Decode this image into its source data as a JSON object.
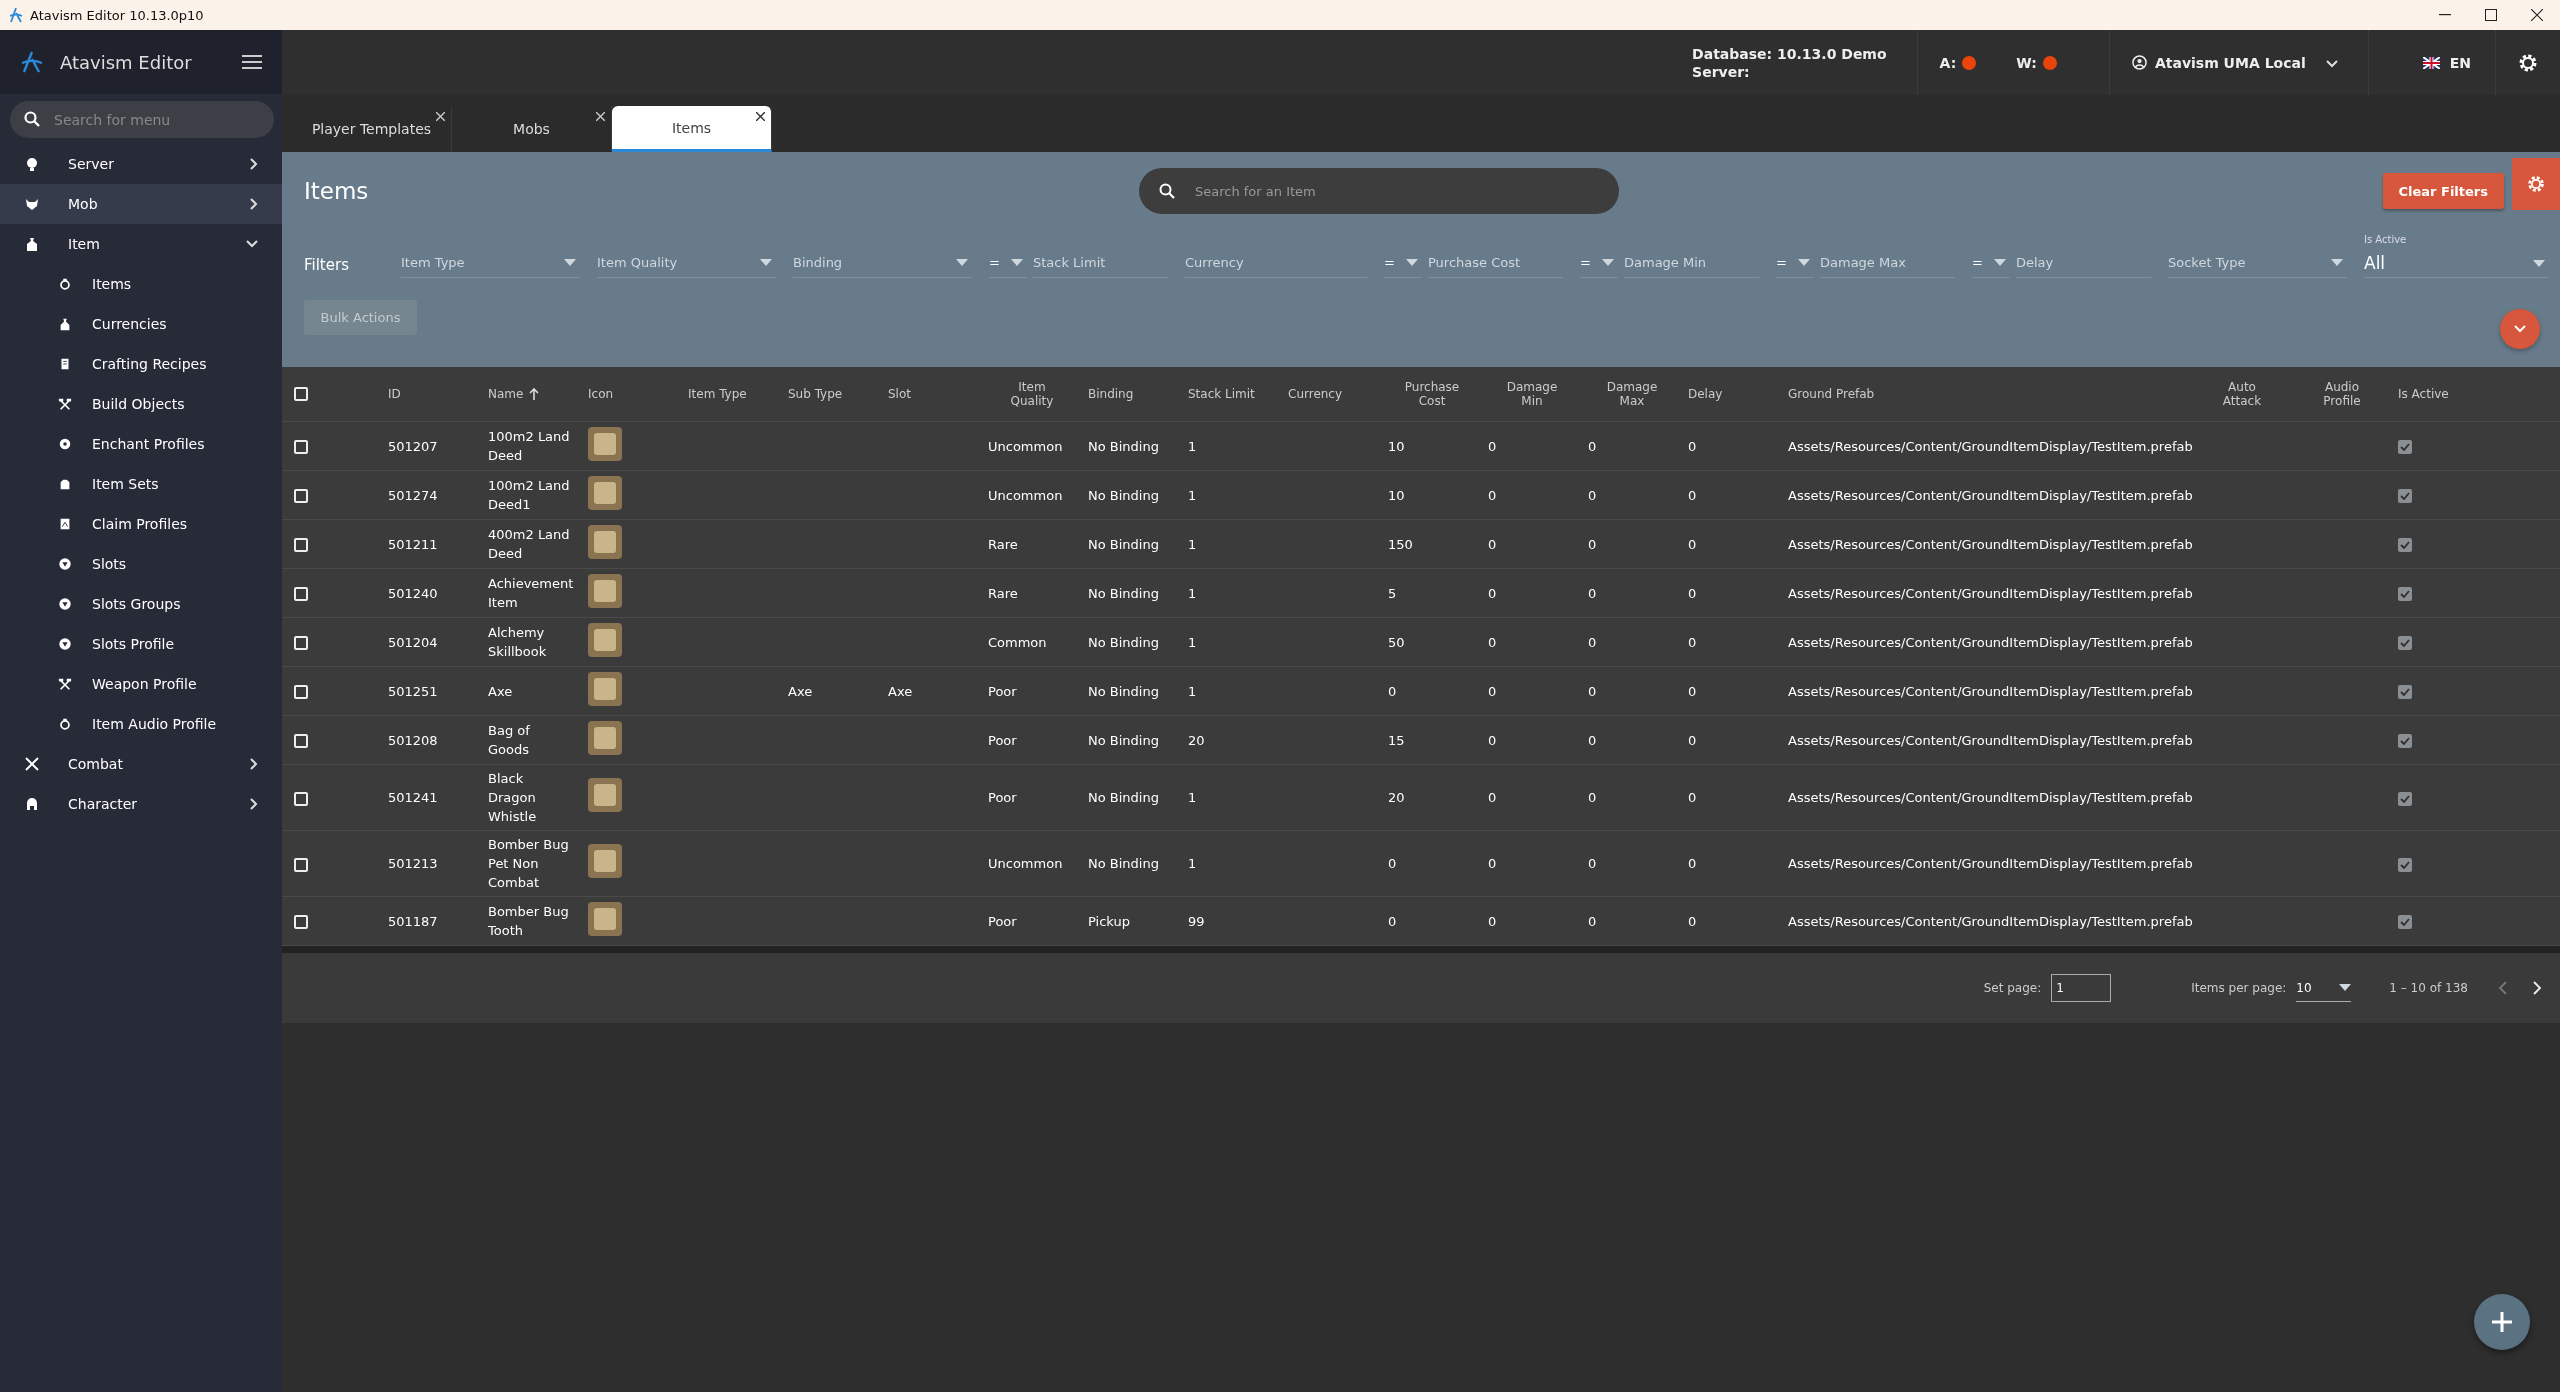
{
  "window": {
    "title": "Atavism Editor 10.13.0p10"
  },
  "sidebar": {
    "brand": "Atavism Editor",
    "search_placeholder": "Search for menu",
    "items": [
      {
        "label": "Server",
        "expanded": false,
        "selected": false
      },
      {
        "label": "Mob",
        "expanded": false,
        "selected": true
      },
      {
        "label": "Item",
        "expanded": true,
        "selected": false,
        "children": [
          {
            "label": "Items"
          },
          {
            "label": "Currencies"
          },
          {
            "label": "Crafting Recipes"
          },
          {
            "label": "Build Objects"
          },
          {
            "label": "Enchant Profiles"
          },
          {
            "label": "Item Sets"
          },
          {
            "label": "Claim Profiles"
          },
          {
            "label": "Slots"
          },
          {
            "label": "Slots Groups"
          },
          {
            "label": "Slots Profile"
          },
          {
            "label": "Weapon Profile"
          },
          {
            "label": "Item Audio Profile"
          }
        ]
      },
      {
        "label": "Combat",
        "expanded": false,
        "selected": false
      },
      {
        "label": "Character",
        "expanded": false,
        "selected": false
      }
    ]
  },
  "topbar": {
    "database": "Database: 10.13.0 Demo",
    "server": "Server:",
    "statuses": [
      {
        "label": "A:",
        "color": "#e8440c"
      },
      {
        "label": "W:",
        "color": "#e8440c"
      }
    ],
    "profile": "Atavism UMA Local",
    "language": "EN"
  },
  "tabs": [
    {
      "label": "Player Templates",
      "selected": false
    },
    {
      "label": "Mobs",
      "selected": false
    },
    {
      "label": "Items",
      "selected": true
    }
  ],
  "panel": {
    "title": "Items",
    "search_placeholder": "Search for an Item",
    "clear_filters": "Clear Filters",
    "filters_label": "Filters",
    "filters": [
      {
        "kind": "select",
        "placeholder": "Item Type"
      },
      {
        "kind": "select",
        "placeholder": "Item Quality"
      },
      {
        "kind": "select",
        "placeholder": "Binding"
      },
      {
        "kind": "compare",
        "operator": "=",
        "placeholder": "Stack Limit"
      },
      {
        "kind": "input",
        "placeholder": "Currency"
      },
      {
        "kind": "compare",
        "operator": "=",
        "placeholder": "Purchase Cost"
      },
      {
        "kind": "compare",
        "operator": "=",
        "placeholder": "Damage Min"
      },
      {
        "kind": "compare",
        "operator": "=",
        "placeholder": "Damage Max"
      },
      {
        "kind": "compare",
        "operator": "=",
        "placeholder": "Delay"
      },
      {
        "kind": "select",
        "placeholder": "Socket Type"
      },
      {
        "kind": "labeled_select",
        "label": "Is Active",
        "value": "All"
      }
    ],
    "bulk_actions": {
      "label": "Bulk Actions",
      "disabled": true
    }
  },
  "table": {
    "all_checked": false,
    "columns": [
      {
        "label": "ID"
      },
      {
        "label": "Name",
        "sorted_ascending": true
      },
      {
        "label": "Icon"
      },
      {
        "label": "Item Type"
      },
      {
        "label": "Sub Type"
      },
      {
        "label": "Slot"
      },
      {
        "label": "Item Quality"
      },
      {
        "label": "Binding"
      },
      {
        "label": "Stack Limit"
      },
      {
        "label": "Currency"
      },
      {
        "label": "Purchase Cost"
      },
      {
        "label": "Damage Min"
      },
      {
        "label": "Damage Max"
      },
      {
        "label": "Delay"
      },
      {
        "label": "Ground Prefab"
      },
      {
        "label": "Auto Attack"
      },
      {
        "label": "Audio Profile"
      },
      {
        "label": "Is Active"
      }
    ],
    "rows": [
      {
        "checked": false,
        "id": "501207",
        "name": "100m2 Land Deed",
        "quality": "Uncommon",
        "binding": "No Binding",
        "stack_limit": "1",
        "purchase_cost": "10",
        "damage_min": "0",
        "damage_max": "0",
        "delay": "0",
        "ground_prefab": "Assets/Resources/Content/GroundItemDisplay/TestItem.prefab",
        "active": true
      },
      {
        "checked": false,
        "id": "501274",
        "name": "100m2 Land Deed1",
        "quality": "Uncommon",
        "binding": "No Binding",
        "stack_limit": "1",
        "purchase_cost": "10",
        "damage_min": "0",
        "damage_max": "0",
        "delay": "0",
        "ground_prefab": "Assets/Resources/Content/GroundItemDisplay/TestItem.prefab",
        "active": true
      },
      {
        "checked": false,
        "id": "501211",
        "name": "400m2 Land Deed",
        "quality": "Rare",
        "binding": "No Binding",
        "stack_limit": "1",
        "purchase_cost": "150",
        "damage_min": "0",
        "damage_max": "0",
        "delay": "0",
        "ground_prefab": "Assets/Resources/Content/GroundItemDisplay/TestItem.prefab",
        "active": true
      },
      {
        "checked": false,
        "id": "501240",
        "name": "Achievement Item",
        "quality": "Rare",
        "binding": "No Binding",
        "stack_limit": "1",
        "purchase_cost": "5",
        "damage_min": "0",
        "damage_max": "0",
        "delay": "0",
        "ground_prefab": "Assets/Resources/Content/GroundItemDisplay/TestItem.prefab",
        "active": true
      },
      {
        "checked": false,
        "id": "501204",
        "name": "Alchemy Skillbook",
        "quality": "Common",
        "binding": "No Binding",
        "stack_limit": "1",
        "purchase_cost": "50",
        "damage_min": "0",
        "damage_max": "0",
        "delay": "0",
        "ground_prefab": "Assets/Resources/Content/GroundItemDisplay/TestItem.prefab",
        "active": true
      },
      {
        "checked": false,
        "id": "501251",
        "name": "Axe",
        "sub_type": "Axe",
        "slot": "Axe",
        "quality": "Poor",
        "binding": "No Binding",
        "stack_limit": "1",
        "purchase_cost": "0",
        "damage_min": "0",
        "damage_max": "0",
        "delay": "0",
        "ground_prefab": "Assets/Resources/Content/GroundItemDisplay/TestItem.prefab",
        "active": true
      },
      {
        "checked": false,
        "id": "501208",
        "name": "Bag of Goods",
        "quality": "Poor",
        "binding": "No Binding",
        "stack_limit": "20",
        "purchase_cost": "15",
        "damage_min": "0",
        "damage_max": "0",
        "delay": "0",
        "ground_prefab": "Assets/Resources/Content/GroundItemDisplay/TestItem.prefab",
        "active": true
      },
      {
        "checked": false,
        "id": "501241",
        "name": "Black Dragon Whistle",
        "quality": "Poor",
        "binding": "No Binding",
        "stack_limit": "1",
        "purchase_cost": "20",
        "damage_min": "0",
        "damage_max": "0",
        "delay": "0",
        "ground_prefab": "Assets/Resources/Content/GroundItemDisplay/TestItem.prefab",
        "active": true
      },
      {
        "checked": false,
        "id": "501213",
        "name": "Bomber Bug Pet Non Combat",
        "quality": "Uncommon",
        "binding": "No Binding",
        "stack_limit": "1",
        "purchase_cost": "0",
        "damage_min": "0",
        "damage_max": "0",
        "delay": "0",
        "ground_prefab": "Assets/Resources/Content/GroundItemDisplay/TestItem.prefab",
        "active": true
      },
      {
        "checked": false,
        "id": "501187",
        "name": "Bomber Bug Tooth",
        "quality": "Poor",
        "binding": "Pickup",
        "stack_limit": "99",
        "purchase_cost": "0",
        "damage_min": "0",
        "damage_max": "0",
        "delay": "0",
        "ground_prefab": "Assets/Resources/Content/GroundItemDisplay/TestItem.prefab",
        "active": true
      }
    ]
  },
  "pager": {
    "set_page_label": "Set page:",
    "page": "1",
    "per_page_label": "Items per page:",
    "per_page": "10",
    "range": "1 – 10 of 138"
  }
}
